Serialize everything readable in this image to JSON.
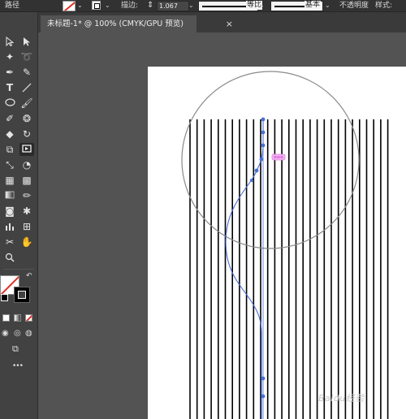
{
  "control_bar": {
    "object_label": "路径",
    "stroke_label": "描边:",
    "stroke_value": "1.067",
    "profile_label": "等比",
    "brush_label": "基本",
    "opacity_label": "不透明度",
    "style_label": "样式:"
  },
  "document_tab": {
    "title": "未标题-1* @ 100% (CMYK/GPU 预览)",
    "close_symbol": "×"
  },
  "toolbar": {
    "more_label": "•••"
  },
  "artwork": {
    "vertical_line_count": 29,
    "line_color": "#000000",
    "path_color": "#4a6fd4",
    "circle_color": "#888888",
    "widget_color": "#e07be0"
  },
  "watermark": {
    "text": "Baidu经验"
  },
  "colors": {
    "ui_dark": "#323232",
    "toolbar": "#424242",
    "canvas": "#535353",
    "none_red": "#e0302a"
  }
}
